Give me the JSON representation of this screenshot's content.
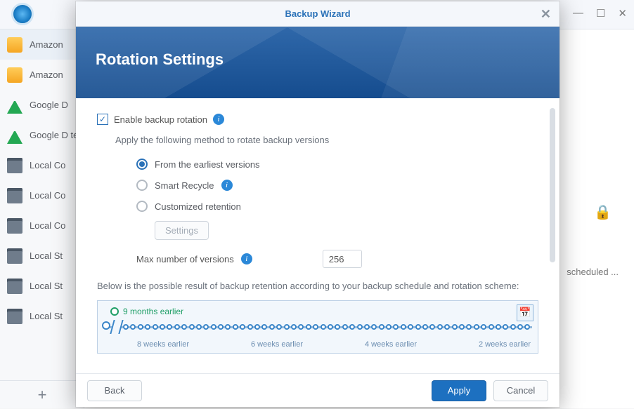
{
  "bg": {
    "sidebar": [
      {
        "label": "Amazon"
      },
      {
        "label": "Amazon"
      },
      {
        "label": "Google D"
      },
      {
        "label": "Google D test"
      },
      {
        "label": "Local Co"
      },
      {
        "label": "Local Co"
      },
      {
        "label": "Local Co"
      },
      {
        "label": "Local St"
      },
      {
        "label": "Local St"
      },
      {
        "label": "Local St"
      }
    ],
    "add_label": "+",
    "lock_glyph": "🔒",
    "scheduled_text": "scheduled ...",
    "win_min": "—",
    "win_max": "☐",
    "win_close": "✕"
  },
  "modal": {
    "title": "Backup Wizard",
    "close_glyph": "✕",
    "banner_title": "Rotation Settings",
    "enable_label": "Enable backup rotation",
    "subtext": "Apply the following method to rotate backup versions",
    "radios": {
      "earliest": "From the earliest versions",
      "smart": "Smart Recycle",
      "custom": "Customized retention"
    },
    "settings_btn": "Settings",
    "max_label": "Max number of versions",
    "max_value": "256",
    "caption": "Below is the possible result of backup retention according to your backup schedule and rotation scheme:",
    "timeline": {
      "earliest_label": "9 months earlier",
      "calendar_glyph": "📅",
      "ticks": [
        "8 weeks earlier",
        "6 weeks earlier",
        "4 weeks earlier",
        "2 weeks earlier"
      ]
    },
    "footer": {
      "back": "Back",
      "apply": "Apply",
      "cancel": "Cancel"
    }
  }
}
